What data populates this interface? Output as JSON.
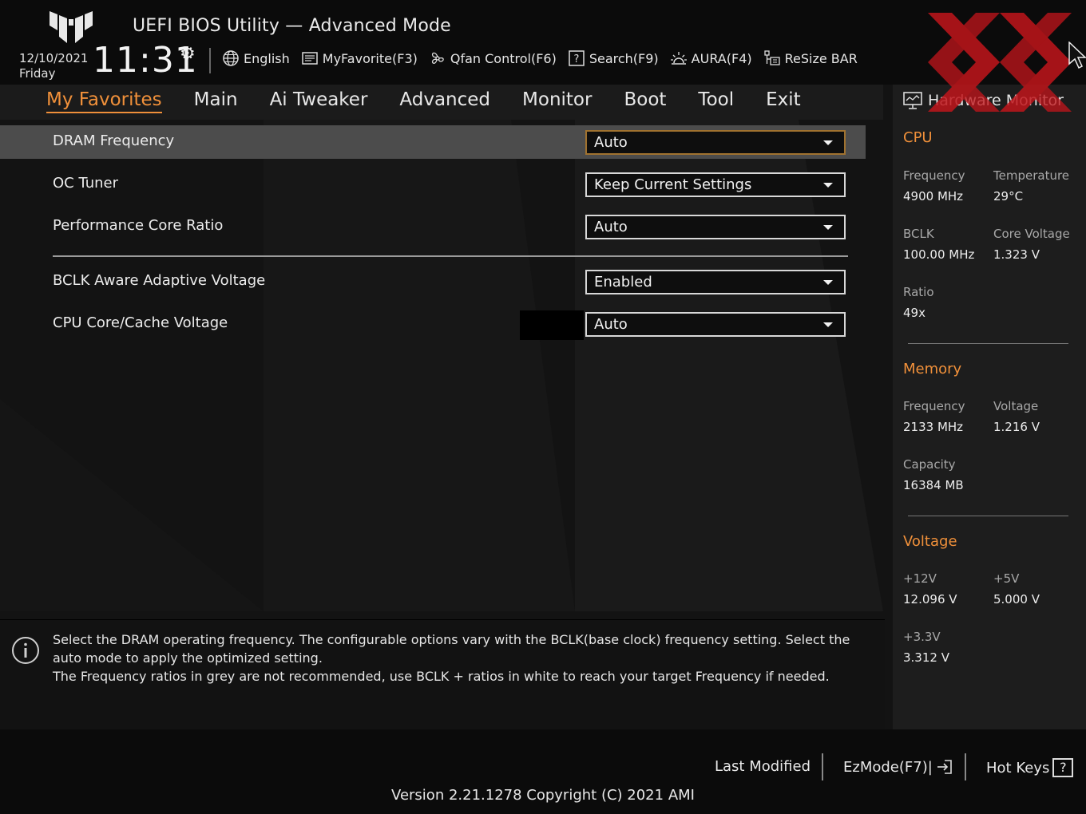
{
  "header": {
    "title": "UEFI BIOS Utility — Advanced Mode",
    "date": "12/10/2021",
    "day": "Friday",
    "time": "11:31",
    "toolbar": [
      {
        "label": "English",
        "icon": "globe-icon"
      },
      {
        "label": "MyFavorite(F3)",
        "icon": "favorite-icon"
      },
      {
        "label": "Qfan Control(F6)",
        "icon": "fan-icon"
      },
      {
        "label": "Search(F9)",
        "icon": "search-icon"
      },
      {
        "label": "AURA(F4)",
        "icon": "aura-icon"
      },
      {
        "label": "ReSize BAR",
        "icon": "resize-bar-icon"
      }
    ]
  },
  "menu": {
    "tabs": [
      "My Favorites",
      "Main",
      "Ai Tweaker",
      "Advanced",
      "Monitor",
      "Boot",
      "Tool",
      "Exit"
    ],
    "active": "My Favorites"
  },
  "settings": [
    {
      "label": "DRAM Frequency",
      "value": "Auto",
      "selected": true
    },
    {
      "label": "OC Tuner",
      "value": "Keep Current Settings",
      "selected": false
    },
    {
      "label": "Performance Core Ratio",
      "value": "Auto",
      "selected": false
    },
    {
      "label": "BCLK Aware Adaptive Voltage",
      "value": "Enabled",
      "selected": false
    },
    {
      "label": "CPU Core/Cache Voltage",
      "value": "Auto",
      "selected": false
    }
  ],
  "help": {
    "line1": "Select the DRAM operating frequency. The configurable options vary with the BCLK(base clock) frequency setting. Select the auto mode to apply the optimized setting.",
    "line2": "The Frequency ratios in grey are not recommended, use BCLK + ratios in white to reach your target Frequency if needed."
  },
  "hardware_monitor": {
    "title": "Hardware Monitor",
    "cpu": {
      "heading": "CPU",
      "frequency_label": "Frequency",
      "frequency": "4900 MHz",
      "temperature_label": "Temperature",
      "temperature": "29°C",
      "bclk_label": "BCLK",
      "bclk": "100.00 MHz",
      "core_voltage_label": "Core Voltage",
      "core_voltage": "1.323 V",
      "ratio_label": "Ratio",
      "ratio": "49x"
    },
    "memory": {
      "heading": "Memory",
      "frequency_label": "Frequency",
      "frequency": "2133 MHz",
      "voltage_label": "Voltage",
      "voltage": "1.216 V",
      "capacity_label": "Capacity",
      "capacity": "16384 MB"
    },
    "voltage": {
      "heading": "Voltage",
      "v12_label": "+12V",
      "v12": "12.096 V",
      "v5_label": "+5V",
      "v5": "5.000 V",
      "v33_label": "+3.3V",
      "v33": "3.312 V"
    }
  },
  "footer": {
    "last_modified": "Last Modified",
    "ezmode": "EzMode(F7)|",
    "hot_keys": "Hot Keys",
    "hot_keys_symbol": "?",
    "version": "Version 2.21.1278 Copyright (C) 2021 AMI"
  },
  "colors": {
    "accent": "#f0903a",
    "selected_row": "#4c4c4c",
    "watermark": "#c0151b"
  }
}
